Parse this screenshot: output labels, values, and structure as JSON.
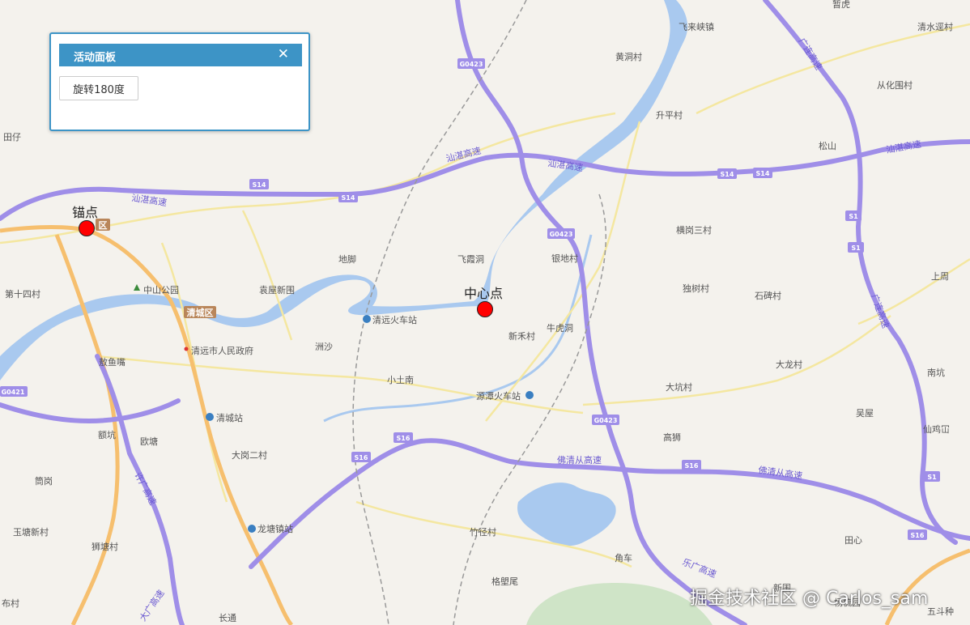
{
  "panel": {
    "title": "活动面板",
    "close_icon": "close-icon",
    "rotate_label": "旋转180度"
  },
  "markers": {
    "anchor": "锚点",
    "center": "中心点",
    "color": "#ff0000"
  },
  "highway_labels": {
    "shantou_zhanjiang": "汕湛高速",
    "fo_qing_cong": "佛清从高速",
    "xu_guang": "许广高速",
    "le_guang": "乐广高速",
    "da_guang": "大广高速",
    "guang_lian": "广连高速"
  },
  "shields": {
    "s14": "S14",
    "s16": "S16",
    "s1": "S1",
    "g0423": "G0423",
    "g0421": "G0421"
  },
  "districts": {
    "qingcheng": "清城区",
    "partial": "区"
  },
  "places": {
    "tianzai": "田仔",
    "gaohuang": "暂虎",
    "qingshuiqu": "清水逕村",
    "conghua": "从化围村",
    "feilai": "飞来峡镇",
    "huangdong": "黄洞村",
    "shengping": "升平村",
    "songshan": "松山",
    "dijiao": "地脚",
    "feixia": "飞霞洞",
    "yindi": "银地村",
    "henggang": "横岗三村",
    "shangzhou": "上周",
    "dishu": "独树村",
    "shibei": "石碑村",
    "di14": "第十四村",
    "zhongshan": "中山公园",
    "yuanwu": "袁屋新围",
    "qingyuan_station": "清远火车站",
    "xinhe": "新禾村",
    "niuhu": "牛虎洞",
    "zhousha": "洲沙",
    "gov": "清远市人民政府",
    "sanyu": "敖鱼嘴",
    "xiaotunan": "小土南",
    "yuantan_station": "源潭火车站",
    "dalong": "大龙村",
    "dawei": "大坑村",
    "nankeng": "南坑",
    "ekeng": "额坑",
    "qingcheng_station": "清城站",
    "outang": "欧塘",
    "gaoshi": "高狮",
    "wuwu": "吴屋",
    "xianji": "仙鸡冚",
    "dagang": "大岗二村",
    "jinggang": "筒岗",
    "yutang": "玉塘新村",
    "longtang_station": "龙塘镇站",
    "zhujing": "竹径村",
    "shitang": "狮塘村",
    "tianxin": "田心",
    "jiaoche": "角车",
    "gesu": "格塱尾",
    "buchun": "布村",
    "changtong": "长通",
    "xinwei": "新围",
    "wudouzhong": "五斗种",
    "yangwu": "杨梳园"
  },
  "watermark": "掘金技术社区 @ Carlos_sam",
  "colors": {
    "water": "#a9c9ef",
    "highway": "#9f8ee8",
    "national_road": "#f6bf6e",
    "minor_road": "#f4e7a0",
    "panel_header": "#3d94c6",
    "background": "#f4f2ed"
  }
}
